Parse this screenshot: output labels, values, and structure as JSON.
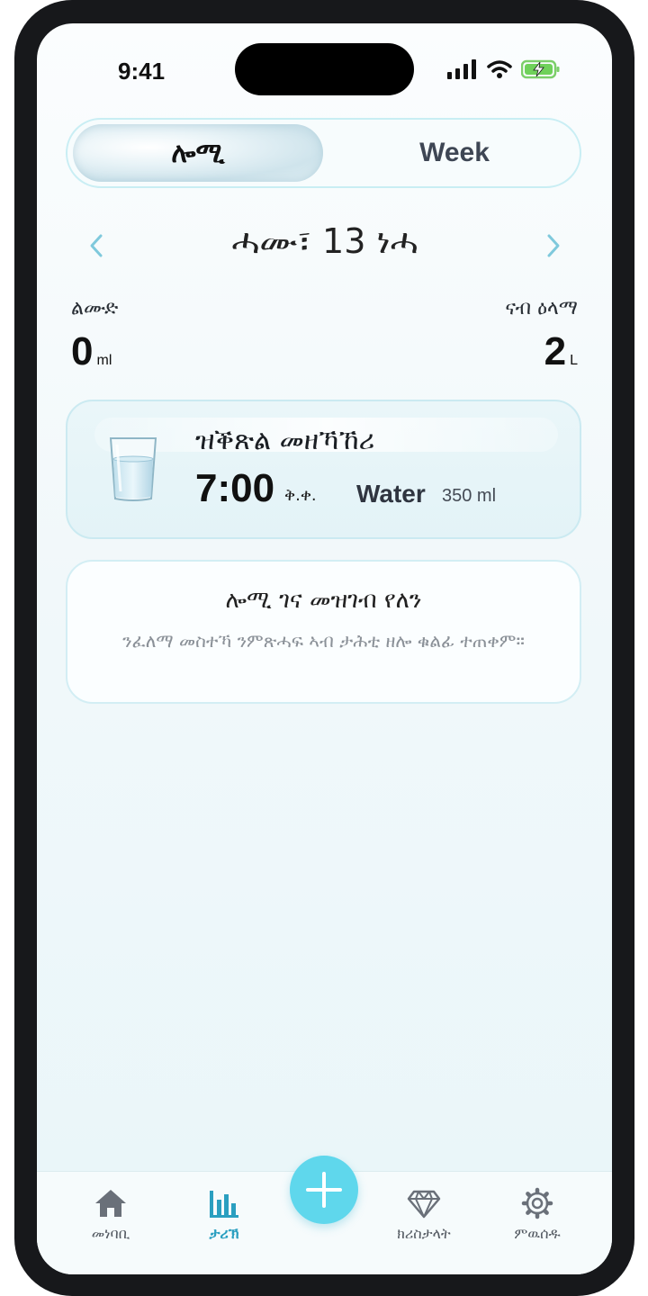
{
  "status_bar": {
    "time": "9:41"
  },
  "segment": {
    "day_label": "ሎሚ",
    "week_label": "Week"
  },
  "date_nav": {
    "title": "ሓሙ፣ 13 ነሓ"
  },
  "stats": {
    "drunk_label": "ልሙድ",
    "drunk_value": "0",
    "drunk_unit": "ml",
    "goal_label": "ናብ ዕላማ",
    "goal_value": "2",
    "goal_unit": "L"
  },
  "reminder": {
    "title": "ዝቕጽል መዘኻኸሪ",
    "time": "7:00",
    "ampm": "ቅ.ቀ.",
    "drink": "Water",
    "amount": "350 ml"
  },
  "empty_state": {
    "title": "ሎሚ ገና መዝገብ የለን",
    "subtitle": "ንፈለማ መስተኻ ንምጽሓፍ ኣብ ታሕቲ ዘሎ ቁልፊ ተጠቀም።"
  },
  "tabbar": {
    "home_label": "መነባቢ",
    "history_label": "ታሪኽ",
    "crystals_label": "ክሪስታላት",
    "settings_label": "ምዉሰዱ"
  },
  "colors": {
    "accent": "#5fd7ec",
    "active_tab": "#2a9fc0",
    "card_border": "#cbeaf1"
  }
}
